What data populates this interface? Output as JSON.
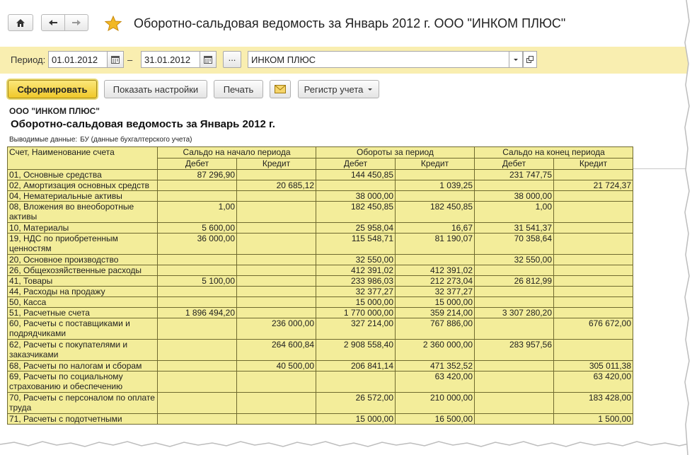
{
  "header": {
    "title": "Оборотно-сальдовая ведомость за Январь 2012 г. ООО \"ИНКОМ ПЛЮС\""
  },
  "period": {
    "label": "Период:",
    "from": "01.01.2012",
    "dash": "–",
    "to": "31.01.2012",
    "dots": "...",
    "organization": "ИНКОМ ПЛЮС"
  },
  "toolbar": {
    "generate": "Сформировать",
    "settings": "Показать настройки",
    "print": "Печать",
    "register": "Регистр учета"
  },
  "report": {
    "org": "ООО \"ИНКОМ ПЛЮС\"",
    "title": "Оборотно-сальдовая ведомость за Январь 2012 г.",
    "data_label": "Выводимые данные:",
    "data_value": "БУ (данные бухгалтерского учета)",
    "headers": {
      "account": "Счет, Наименование счета",
      "open": "Сальдо на начало периода",
      "turn": "Обороты за период",
      "close": "Сальдо на конец периода",
      "debit": "Дебет",
      "credit": "Кредит"
    },
    "rows": [
      {
        "account": "01, Основные средства",
        "od": "87 296,90",
        "oc": "",
        "td": "144 450,85",
        "tc": "",
        "cd": "231 747,75",
        "cc": ""
      },
      {
        "account": "02, Амортизация основных средств",
        "od": "",
        "oc": "20 685,12",
        "td": "",
        "tc": "1 039,25",
        "cd": "",
        "cc": "21 724,37"
      },
      {
        "account": "04, Нематериальные активы",
        "od": "",
        "oc": "",
        "td": "38 000,00",
        "tc": "",
        "cd": "38 000,00",
        "cc": ""
      },
      {
        "account": "08, Вложения во внеоборотные активы",
        "od": "1,00",
        "oc": "",
        "td": "182 450,85",
        "tc": "182 450,85",
        "cd": "1,00",
        "cc": ""
      },
      {
        "account": "10, Материалы",
        "od": "5 600,00",
        "oc": "",
        "td": "25 958,04",
        "tc": "16,67",
        "cd": "31 541,37",
        "cc": ""
      },
      {
        "account": "19, НДС по приобретенным ценностям",
        "od": "36 000,00",
        "oc": "",
        "td": "115 548,71",
        "tc": "81 190,07",
        "cd": "70 358,64",
        "cc": ""
      },
      {
        "account": "20, Основное производство",
        "od": "",
        "oc": "",
        "td": "32 550,00",
        "tc": "",
        "cd": "32 550,00",
        "cc": ""
      },
      {
        "account": "26, Общехозяйственные расходы",
        "od": "",
        "oc": "",
        "td": "412 391,02",
        "tc": "412 391,02",
        "cd": "",
        "cc": ""
      },
      {
        "account": "41, Товары",
        "od": "5 100,00",
        "oc": "",
        "td": "233 986,03",
        "tc": "212 273,04",
        "cd": "26 812,99",
        "cc": ""
      },
      {
        "account": "44, Расходы на продажу",
        "od": "",
        "oc": "",
        "td": "32 377,27",
        "tc": "32 377,27",
        "cd": "",
        "cc": ""
      },
      {
        "account": "50, Касса",
        "od": "",
        "oc": "",
        "td": "15 000,00",
        "tc": "15 000,00",
        "cd": "",
        "cc": ""
      },
      {
        "account": "51, Расчетные счета",
        "od": "1 896 494,20",
        "oc": "",
        "td": "1 770 000,00",
        "tc": "359 214,00",
        "cd": "3 307 280,20",
        "cc": ""
      },
      {
        "account": "60, Расчеты с поставщиками и подрядчиками",
        "od": "",
        "oc": "236 000,00",
        "td": "327 214,00",
        "tc": "767 886,00",
        "cd": "",
        "cc": "676 672,00"
      },
      {
        "account": "62, Расчеты с покупателями и заказчиками",
        "od": "",
        "oc": "264 600,84",
        "td": "2 908 558,40",
        "tc": "2 360 000,00",
        "cd": "283 957,56",
        "cc": ""
      },
      {
        "account": "68, Расчеты по налогам и сборам",
        "od": "",
        "oc": "40 500,00",
        "td": "206 841,14",
        "tc": "471 352,52",
        "cd": "",
        "cc": "305 011,38"
      },
      {
        "account": "69, Расчеты по социальному страхованию и обеспечению",
        "od": "",
        "oc": "",
        "td": "",
        "tc": "63 420,00",
        "cd": "",
        "cc": "63 420,00"
      },
      {
        "account": "70, Расчеты с персоналом по оплате труда",
        "od": "",
        "oc": "",
        "td": "26 572,00",
        "tc": "210 000,00",
        "cd": "",
        "cc": "183 428,00"
      },
      {
        "account": "71, Расчеты с подотчетными",
        "od": "",
        "oc": "",
        "td": "15 000,00",
        "tc": "16 500,00",
        "cd": "",
        "cc": "1 500,00"
      }
    ]
  },
  "icons": {
    "home": "home-icon",
    "back": "arrow-left-icon",
    "forward": "arrow-right-icon",
    "favorite": "star-icon",
    "calendar": "calendar-icon",
    "dropdown": "chevron-down-icon",
    "open": "open-window-icon",
    "mail": "envelope-icon"
  },
  "colors": {
    "accent": "#f9eeb0",
    "table": "#f3ed9a",
    "primary_button": "#f0c82a",
    "star": "#f2b824"
  }
}
